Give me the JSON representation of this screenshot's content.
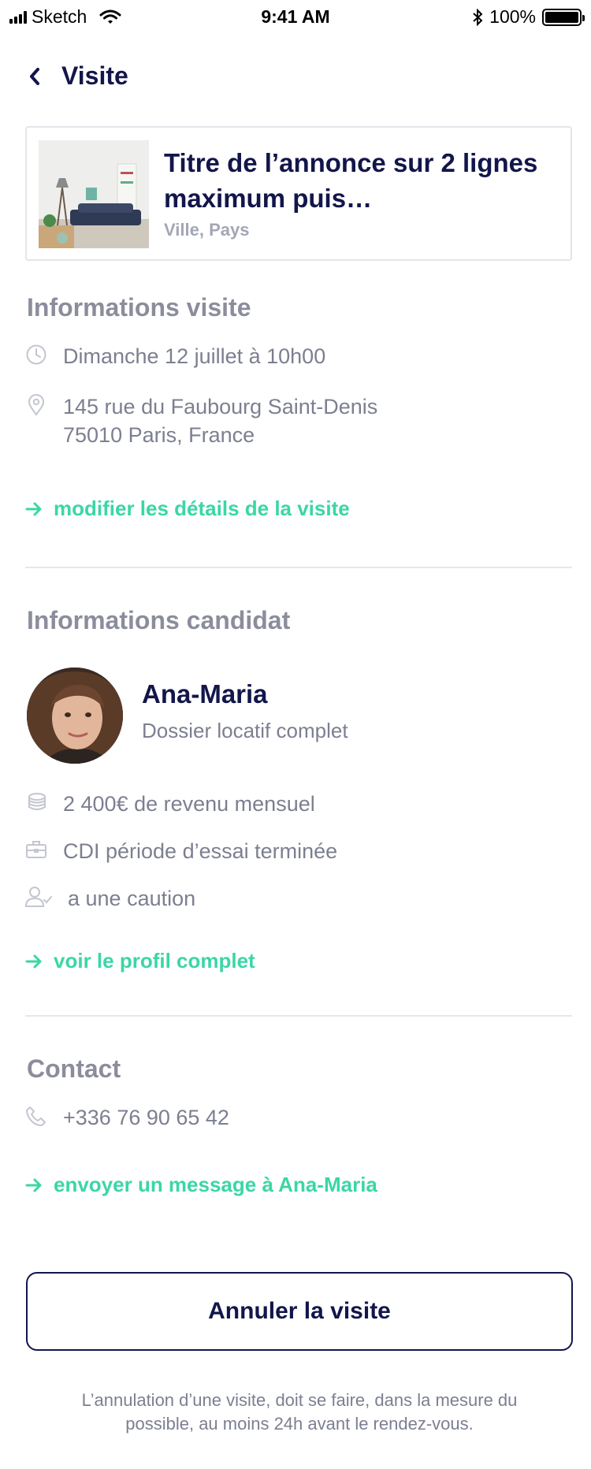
{
  "status_bar": {
    "carrier": "Sketch",
    "time": "9:41 AM",
    "battery": "100%"
  },
  "header": {
    "title": "Visite"
  },
  "listing": {
    "title": "Titre de l’annonce sur 2 lignes maximum puis…",
    "location": "Ville, Pays"
  },
  "visit": {
    "section_title": "Informations visite",
    "date": "Dimanche 12 juillet à 10h00",
    "address_line1": "145 rue du Faubourg Saint-Denis",
    "address_line2": "75010 Paris, France",
    "edit_link": "modifier les détails de la visite"
  },
  "candidate": {
    "section_title": "Informations candidat",
    "name": "Ana-Maria",
    "status": "Dossier locatif complet",
    "income": "2 400€ de revenu mensuel",
    "contract": "CDI  période d’essai terminée",
    "guarantor": "a une caution",
    "profile_link": "voir le profil complet"
  },
  "contact": {
    "section_title": "Contact",
    "phone": "+336 76 90 65 42",
    "message_link": "envoyer un message à Ana-Maria"
  },
  "actions": {
    "cancel_label": "Annuler la visite",
    "disclaimer": "L’annulation d’une visite, doit se faire, dans la mesure du possible, au moins 24h avant le rendez-vous."
  },
  "colors": {
    "accent": "#3bd6a6",
    "navy": "#12164a",
    "muted": "#7c7f90",
    "section": "#8b8d9c"
  },
  "icons": [
    "signal-icon",
    "wifi-icon",
    "bluetooth-icon",
    "battery-icon",
    "chevron-left-icon",
    "clock-icon",
    "location-pin-icon",
    "arrow-right-icon",
    "coins-icon",
    "briefcase-icon",
    "user-check-icon",
    "phone-icon"
  ]
}
